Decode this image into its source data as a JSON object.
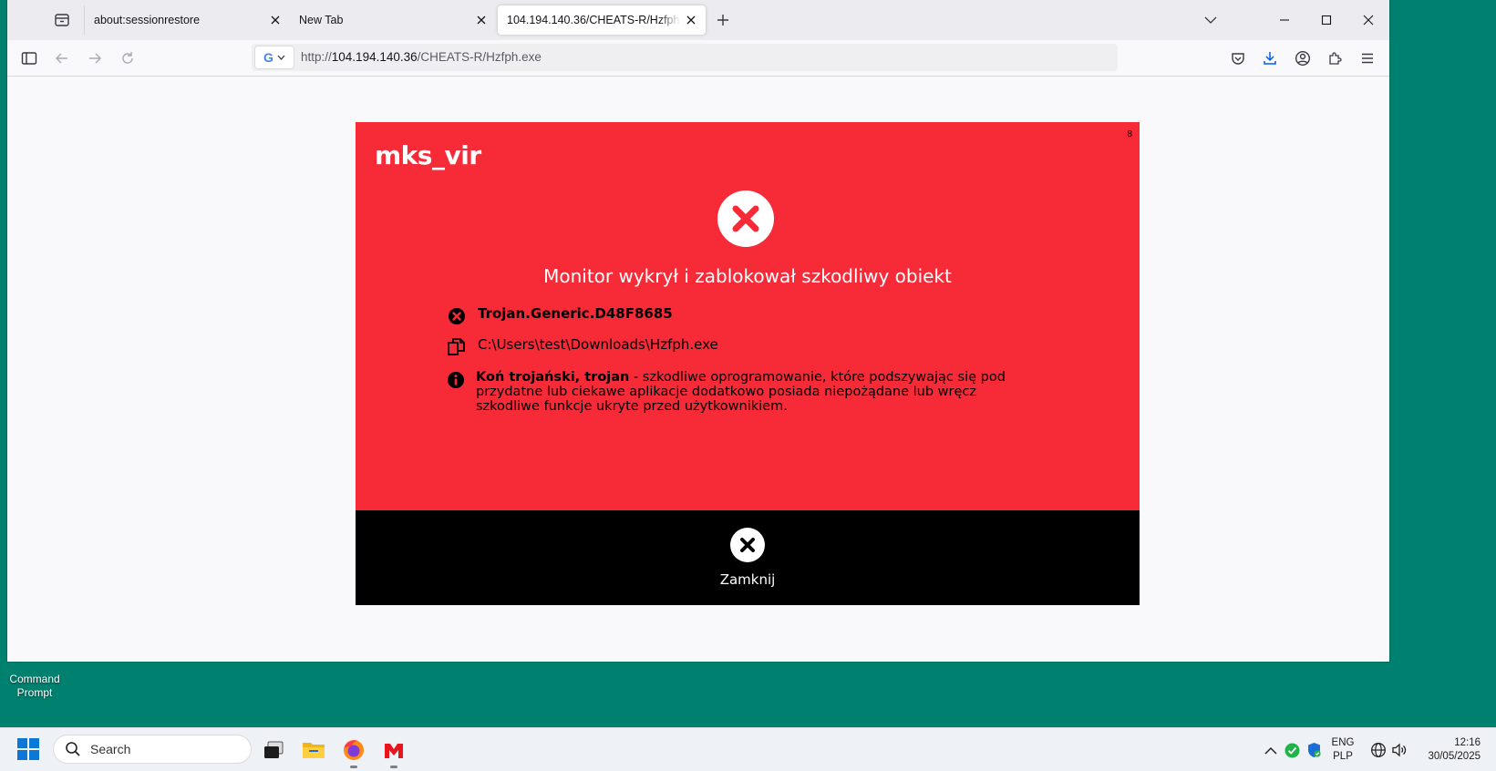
{
  "desktop": {
    "icons": [
      {
        "label": "Command Prompt"
      }
    ]
  },
  "browser": {
    "tabs": [
      {
        "title": "about:sessionrestore"
      },
      {
        "title": "New Tab"
      },
      {
        "title": "104.194.140.36/CHEATS-R/Hzfph.exe"
      }
    ],
    "address": {
      "scheme": "http://",
      "host": "104.194.140.36",
      "path": "/CHEATS-R/Hzfph.exe",
      "engine_letter": "G"
    }
  },
  "dialog": {
    "brand": "mks_vir",
    "corner_number": "8",
    "title": "Monitor wykrył i zablokował szkodliwy obiekt",
    "threat_name": "Trojan.Generic.D48F8685",
    "file_path": "C:\\Users\\test\\Downloads\\Hzfph.exe",
    "description_term": "Koń trojański, trojan",
    "description_text": " - szkodliwe oprogramowanie, które podszywając się pod przydatne lub ciekawe aplikacje dodatkowo posiada niepożądane lub wręcz szkodliwe funkcje ukryte przed użytkownikiem.",
    "close_label": "Zamknij",
    "colors": {
      "alert_bg": "#f72a38",
      "footer_bg": "#000000",
      "accent": "#ffffff"
    }
  },
  "taskbar": {
    "search_placeholder": "Search",
    "language": "ENG",
    "keyboard": "PLP",
    "time": "12:16",
    "date": "30/05/2025",
    "apps": [
      "file-explorer-icon",
      "firefox-icon",
      "mks-vir-icon"
    ]
  }
}
